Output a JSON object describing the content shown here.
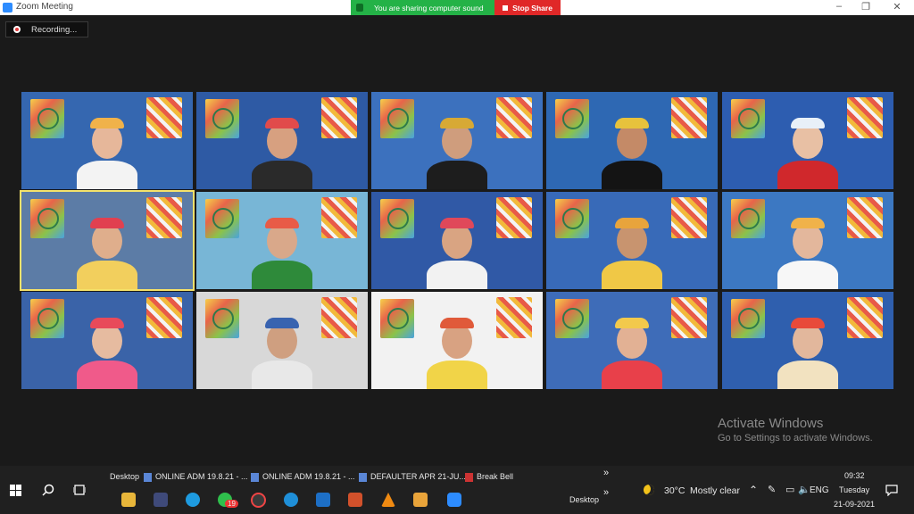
{
  "window": {
    "title": "Zoom Meeting"
  },
  "share": {
    "status": "You are sharing computer sound",
    "stop_label": "Stop Share"
  },
  "window_controls": {
    "minimize": "–",
    "restore": "❐",
    "close": "✕"
  },
  "recording": {
    "label": "Recording..."
  },
  "participants": [
    {
      "wall": "#3567b0",
      "skin": "#e6b79a",
      "shirt": "#f3f3f3",
      "accent": "#f0b24a"
    },
    {
      "wall": "#2e5aa4",
      "skin": "#d7a080",
      "shirt": "#2a2a2a",
      "accent": "#e14b4b"
    },
    {
      "wall": "#3c71be",
      "skin": "#cf9d7d",
      "shirt": "#1d1d1d",
      "accent": "#d7a935"
    },
    {
      "wall": "#2e68b3",
      "skin": "#c48a67",
      "shirt": "#141414",
      "accent": "#e7c23c"
    },
    {
      "wall": "#2d5db0",
      "skin": "#e8c0a4",
      "shirt": "#d0282c",
      "accent": "#e8f0f8"
    },
    {
      "wall": "#5c7ca6",
      "skin": "#dfae8c",
      "shirt": "#f2cf5d",
      "accent": "#e14050"
    },
    {
      "wall": "#78b6d6",
      "skin": "#d9a88a",
      "shirt": "#2e8a3a",
      "accent": "#e85b47"
    },
    {
      "wall": "#3059a6",
      "skin": "#d9a482",
      "shirt": "#f2f2f2",
      "accent": "#e0485a"
    },
    {
      "wall": "#386ab8",
      "skin": "#c8946f",
      "shirt": "#f0c846",
      "accent": "#e8a43c"
    },
    {
      "wall": "#3c78c2",
      "skin": "#e3b79c",
      "shirt": "#f7f7f7",
      "accent": "#f0b24a"
    },
    {
      "wall": "#3a63a8",
      "skin": "#e6bba0",
      "shirt": "#f05a8a",
      "accent": "#e84a5a"
    },
    {
      "wall": "#d8d8d8",
      "skin": "#cf9f80",
      "shirt": "#e8e8e8",
      "accent": "#3863b0"
    },
    {
      "wall": "#f2f2f2",
      "skin": "#d8a282",
      "shirt": "#f1d448",
      "accent": "#e05a3a"
    },
    {
      "wall": "#3e6cb8",
      "skin": "#e2b194",
      "shirt": "#e8404a",
      "accent": "#f2c94c"
    },
    {
      "wall": "#2f5fae",
      "skin": "#e2b79c",
      "shirt": "#f2e2c0",
      "accent": "#e84a3a"
    }
  ],
  "activation": {
    "title": "Activate Windows",
    "subtitle": "Go to Settings to activate Windows."
  },
  "taskbar": {
    "desktop_label": "Desktop",
    "items": [
      "ONLINE ADM 19.8.21 - ...",
      "ONLINE ADM 19.8.21 - ...",
      "DEFAULTER APR 21-JU...",
      "Break Bell"
    ],
    "overflow": "»",
    "desktop_label_2": "Desktop",
    "overflow_2": "»",
    "weather": {
      "temp": "30°C",
      "condition": "Mostly clear"
    },
    "language": "ENG",
    "time": "09:32",
    "day": "Tuesday",
    "date": "21-09-2021",
    "whatsapp_badge": "19"
  }
}
